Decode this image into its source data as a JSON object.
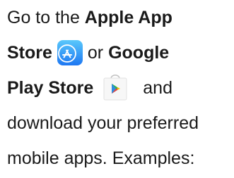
{
  "paragraph": {
    "l1_pre": "Go to the ",
    "l1_bold": "Apple App",
    "l2_bold": "Store",
    "l2_mid": "or ",
    "l2_bold2": "Google",
    "l3_bold": "Play Store",
    "l3_post": "and",
    "l4": "download your preferred",
    "l5": "mobile apps. Examples:"
  },
  "icons": {
    "app_store": "app-store-icon",
    "google_play": "google-play-store-icon"
  },
  "colors": {
    "app_store_top": "#5ac8fb",
    "app_store_bottom": "#1d77f2",
    "play_bag": "#f7f7f7",
    "play_blue": "#2f8ee0",
    "play_green": "#38b54a",
    "play_red": "#e8453c",
    "play_yellow": "#f6c100"
  }
}
